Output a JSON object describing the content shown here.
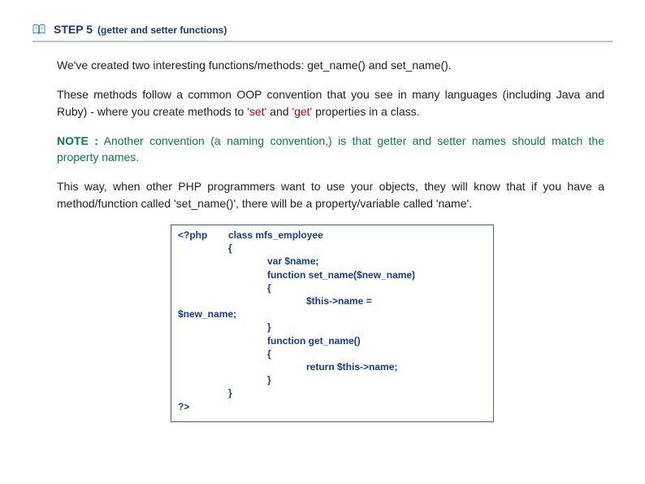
{
  "header": {
    "icon": "book-icon",
    "step_label": "STEP 5",
    "subtitle": "(getter and setter functions)"
  },
  "body": {
    "p1": "We've created two interesting functions/methods: get_name() and set_name().",
    "p2_a": "These methods follow a common OOP convention that you see in many languages (including Java and Ruby) - where you create methods to ",
    "p2_set": "'set'",
    "p2_and": " and ",
    "p2_get": "'get'",
    "p2_b": " properties in a class.",
    "p3_note": "NOTE :",
    "p3_rest": " Another convention (a naming convention,) is that getter and setter names should match the property names.",
    "p4": "This way, when other PHP programmers want to use your objects, they will know that if you have a method/function called 'set_name()', there will be a property/variable called 'name'."
  },
  "code": {
    "open": "<?php",
    "class_line": "class mfs_employee",
    "brace_open": "{",
    "var_line": "var $name;",
    "fn_set": "function set_name($new_name)",
    "brace_open2": "{",
    "this_assign": "$this->name =",
    "new_name": "$new_name;",
    "brace_close": "}",
    "fn_get": "function get_name()",
    "brace_open3": "{",
    "return_line": "return $this->name;",
    "brace_close2": "}",
    "brace_close_outer": "}",
    "close": "?>"
  }
}
